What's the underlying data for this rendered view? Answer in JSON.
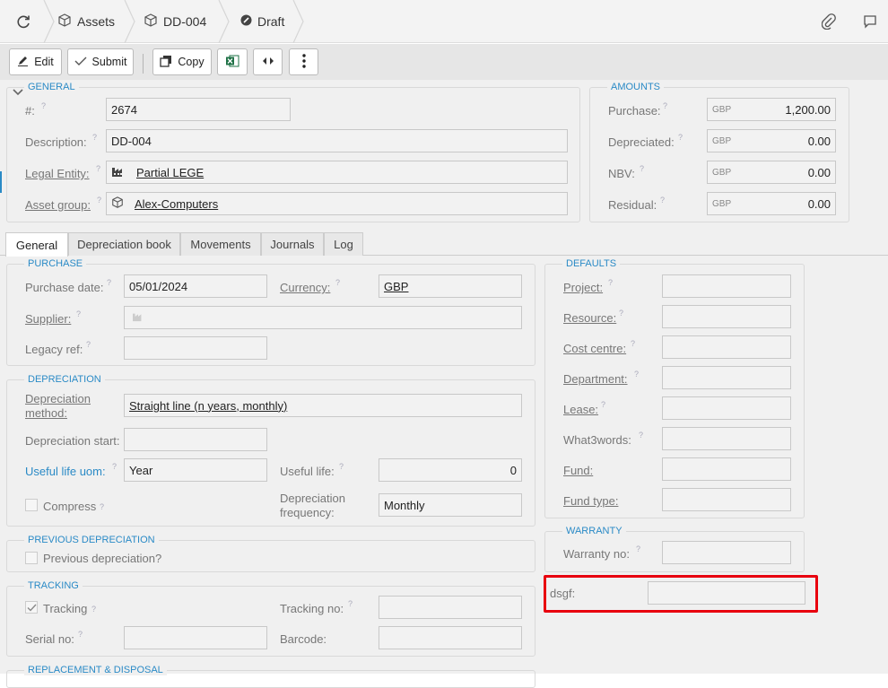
{
  "topbar": {
    "crumbs": [
      "Assets",
      "DD-004",
      "Draft"
    ]
  },
  "toolbar": {
    "edit": "Edit",
    "submit": "Submit",
    "copy": "Copy"
  },
  "general": {
    "title": "GENERAL",
    "number_label": "#:",
    "number_value": "2674",
    "description_label": "Description:",
    "description_value": "DD-004",
    "legal_entity_label": "Legal Entity:",
    "legal_entity_value": "Partial LEGE",
    "asset_group_label": "Asset group:",
    "asset_group_value": "Alex-Computers"
  },
  "amounts": {
    "title": "AMOUNTS",
    "currency": "GBP",
    "purchase_label": "Purchase:",
    "purchase_value": "1,200.00",
    "depreciated_label": "Depreciated:",
    "depreciated_value": "0.00",
    "nbv_label": "NBV:",
    "nbv_value": "0.00",
    "residual_label": "Residual:",
    "residual_value": "0.00"
  },
  "tabs": [
    "General",
    "Depreciation book",
    "Movements",
    "Journals",
    "Log"
  ],
  "purchase": {
    "title": "PURCHASE",
    "date_label": "Purchase date:",
    "date_value": "05/01/2024",
    "currency_label": "Currency:",
    "currency_value": "GBP",
    "supplier_label": "Supplier:",
    "legacy_label": "Legacy ref:"
  },
  "depreciation": {
    "title": "DEPRECIATION",
    "method_label_1": "Depreciation",
    "method_label_2": "method:",
    "method_value": "Straight line (n years, monthly)",
    "start_label": "Depreciation start:",
    "uom_label": "Useful life uom:",
    "uom_value": "Year",
    "life_label": "Useful life:",
    "life_value": "0",
    "compress_label": "Compress",
    "freq_label_1": "Depreciation",
    "freq_label_2": "frequency:",
    "freq_value": "Monthly"
  },
  "previous": {
    "title": "PREVIOUS DEPRECIATION",
    "label": "Previous depreciation?"
  },
  "tracking": {
    "title": "TRACKING",
    "tracking_label": "Tracking",
    "tracking_no_label": "Tracking no:",
    "serial_label": "Serial no:",
    "barcode_label": "Barcode:"
  },
  "replacement": {
    "title": "REPLACEMENT & DISPOSAL"
  },
  "defaults": {
    "title": "DEFAULTS",
    "project": "Project:",
    "resource": "Resource:",
    "cost_centre": "Cost centre:",
    "department": "Department:",
    "lease": "Lease:",
    "what3words": "What3words:",
    "fund": "Fund:",
    "fund_type": "Fund type:"
  },
  "warranty": {
    "title": "WARRANTY",
    "no_label": "Warranty no:"
  },
  "custom": {
    "label": "dsgf:"
  },
  "help_mark": "?",
  "colors": {
    "accent": "#2a8ac6",
    "highlight": "#e8000e",
    "excel": "#1e7145"
  }
}
